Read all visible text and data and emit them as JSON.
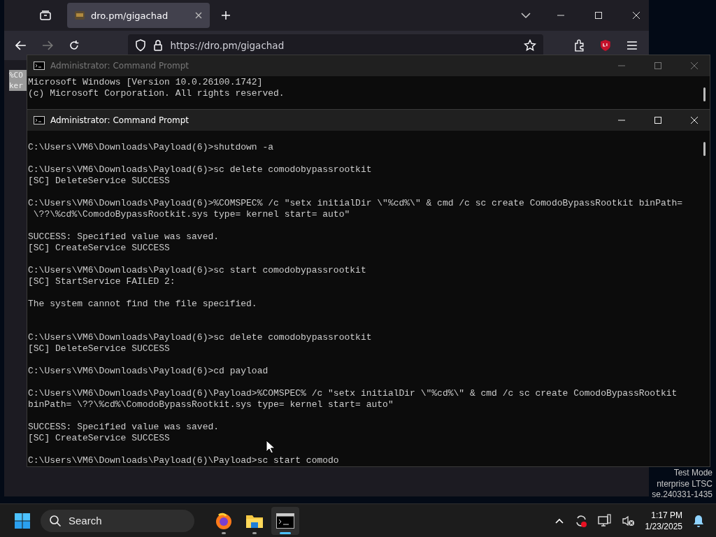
{
  "browser": {
    "tabs": [
      {
        "title": "dro.pm/gigachad",
        "selected": true
      }
    ],
    "address": "https://dro.pm/gigachad",
    "page_fragment": [
      "%CO",
      "ker"
    ]
  },
  "console_windows": [
    {
      "title": "Administrator: Command Prompt",
      "active": false,
      "blocks": [
        {
          "lines": [
            "Microsoft Windows [Version 10.0.26100.1742]",
            "(c) Microsoft Corporation. All rights reserved."
          ],
          "double_gap": false
        }
      ]
    },
    {
      "title": "Administrator: Command Prompt",
      "active": true,
      "blocks": [
        {
          "lines": [
            "C:\\Users\\VM6\\Downloads\\Payload(6)>shutdown -a"
          ],
          "double_gap": false
        },
        {
          "lines": [
            "C:\\Users\\VM6\\Downloads\\Payload(6)>sc delete comodobypassrootkit",
            "[SC] DeleteService SUCCESS"
          ],
          "double_gap": false
        },
        {
          "lines": [
            "C:\\Users\\VM6\\Downloads\\Payload(6)>%COMSPEC% /c \"setx initialDir \\\"%cd%\\\" & cmd /c sc create ComodoBypassRootkit binPath=",
            " \\??\\%cd%\\ComodoBypassRootkit.sys type= kernel start= auto\""
          ],
          "double_gap": false
        },
        {
          "lines": [
            "SUCCESS: Specified value was saved.",
            "[SC] CreateService SUCCESS"
          ],
          "double_gap": false
        },
        {
          "lines": [
            "C:\\Users\\VM6\\Downloads\\Payload(6)>sc start comodobypassrootkit",
            "[SC] StartService FAILED 2:"
          ],
          "double_gap": false
        },
        {
          "lines": [
            "The system cannot find the file specified."
          ],
          "double_gap": true
        },
        {
          "lines": [
            "C:\\Users\\VM6\\Downloads\\Payload(6)>sc delete comodobypassrootkit",
            "[SC] DeleteService SUCCESS"
          ],
          "double_gap": false
        },
        {
          "lines": [
            "C:\\Users\\VM6\\Downloads\\Payload(6)>cd payload"
          ],
          "double_gap": false
        },
        {
          "lines": [
            "C:\\Users\\VM6\\Downloads\\Payload(6)\\Payload>%COMSPEC% /c \"setx initialDir \\\"%cd%\\\" & cmd /c sc create ComodoBypassRootkit",
            "binPath= \\??\\%cd%\\ComodoBypassRootkit.sys type= kernel start= auto\""
          ],
          "double_gap": false
        },
        {
          "lines": [
            "SUCCESS: Specified value was saved.",
            "[SC] CreateService SUCCESS"
          ],
          "double_gap": false
        },
        {
          "lines": [
            "C:\\Users\\VM6\\Downloads\\Payload(6)\\Payload>sc start comodo"
          ],
          "double_gap": false
        }
      ]
    }
  ],
  "desktop_notice": [
    "Test Mode",
    "nterprise LTSC",
    "se.240331-1435"
  ],
  "taskbar": {
    "search_placeholder": "Search",
    "apps": [
      {
        "kind": "firefox",
        "selected": false
      },
      {
        "kind": "files",
        "selected": false
      },
      {
        "kind": "terminal",
        "selected": true
      }
    ],
    "time": "1:17 PM",
    "date": "1/23/2025"
  }
}
